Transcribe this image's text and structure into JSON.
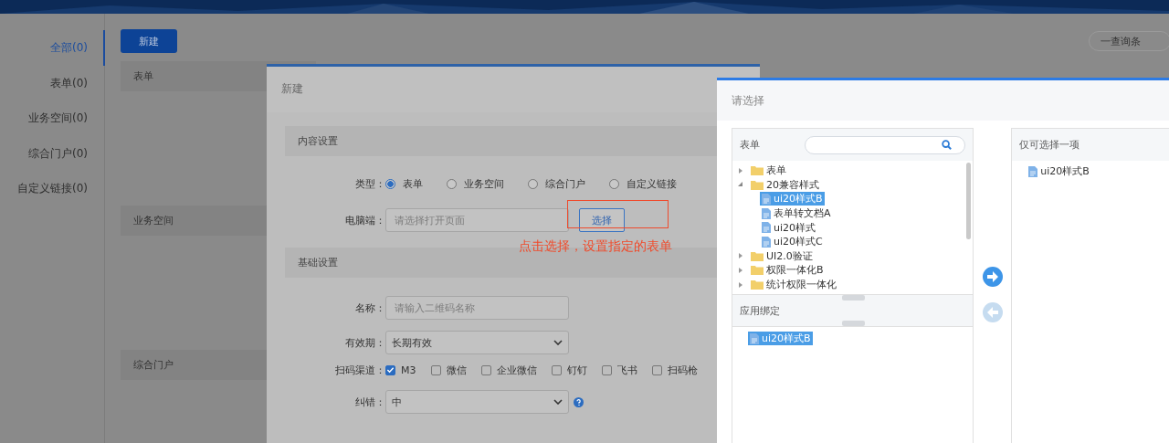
{
  "sidebar": {
    "items": [
      {
        "label": "全部(0)",
        "selected": true
      },
      {
        "label": "表单(0)",
        "selected": false
      },
      {
        "label": "业务空间(0)",
        "selected": false
      },
      {
        "label": "综合门户(0)",
        "selected": false
      },
      {
        "label": "自定义链接(0)",
        "selected": false
      }
    ]
  },
  "toolbar": {
    "new_button": "新建",
    "query_button": "一查询条"
  },
  "sections": [
    {
      "title": "表单"
    },
    {
      "title": "业务空间"
    },
    {
      "title": "综合门户"
    }
  ],
  "new_dialog": {
    "title": "新建",
    "content_section": "内容设置",
    "type_label": "类型：",
    "types": [
      {
        "label": "表单",
        "selected": true
      },
      {
        "label": "业务空间",
        "selected": false
      },
      {
        "label": "综合门户",
        "selected": false
      },
      {
        "label": "自定义链接",
        "selected": false
      }
    ],
    "pc_label": "电脑端：",
    "pc_field": {
      "placeholder": "请选择打开页面"
    },
    "choose_button": "选择",
    "annotation": "点击选择，设置指定的表单",
    "basic_section": "基础设置",
    "name_label": "名称：",
    "name_field": {
      "placeholder": "请输入二维码名称"
    },
    "validity_label": "有效期：",
    "validity_value": "长期有效",
    "channels_label": "扫码渠道：",
    "channels": [
      {
        "label": "M3",
        "checked": true
      },
      {
        "label": "微信",
        "checked": false
      },
      {
        "label": "企业微信",
        "checked": false
      },
      {
        "label": "钉钉",
        "checked": false
      },
      {
        "label": "飞书",
        "checked": false
      },
      {
        "label": "扫码枪",
        "checked": false
      }
    ],
    "correction_label": "纠错：",
    "correction_value": "中"
  },
  "select_dialog": {
    "title": "请选择",
    "left_title": "表单",
    "tree": [
      {
        "label": "表单",
        "kind": "folder",
        "expanded": false,
        "selected": false
      },
      {
        "label": "20兼容样式",
        "kind": "folder",
        "expanded": true,
        "selected": false,
        "children": [
          {
            "label": "ui20样式B",
            "kind": "file",
            "selected": true
          },
          {
            "label": "表单转文档A",
            "kind": "file",
            "selected": false
          },
          {
            "label": "ui20样式",
            "kind": "file",
            "selected": false
          },
          {
            "label": "ui20样式C",
            "kind": "file",
            "selected": false
          }
        ]
      },
      {
        "label": "UI2.0验证",
        "kind": "folder",
        "expanded": false,
        "selected": false
      },
      {
        "label": "权限一体化B",
        "kind": "folder",
        "expanded": false,
        "selected": false
      },
      {
        "label": "统计权限一体化",
        "kind": "folder",
        "expanded": false,
        "selected": false
      }
    ],
    "binding_title": "应用绑定",
    "binding_items": [
      {
        "label": "ui20样式B",
        "selected": true
      }
    ],
    "move_right": {
      "disabled": false
    },
    "move_left": {
      "disabled": true
    },
    "right_title": "仅可选择一项",
    "right_items": [
      {
        "label": "ui20样式B"
      }
    ]
  }
}
